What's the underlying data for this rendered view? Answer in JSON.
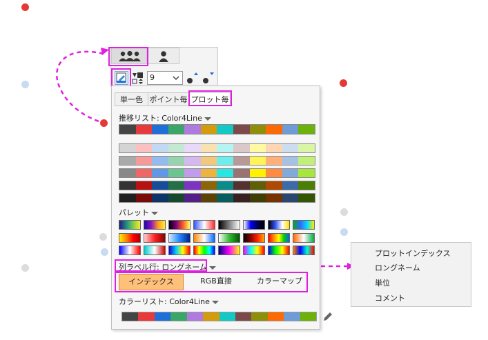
{
  "toolbar": {
    "tabs": [
      {
        "icon": "users-group-icon",
        "active": true
      },
      {
        "icon": "user-icon",
        "active": false
      }
    ],
    "size_value": "9"
  },
  "popup": {
    "tabs": [
      "単一色",
      "ポイント毎",
      "プロット毎"
    ],
    "active_tab": "プロット毎",
    "incremental_list_label": "推移リスト: Color4Line",
    "palette_label": "パレット",
    "column_label_row_label": "列ラベル行: ロングネーム",
    "mode_buttons": [
      "インデックス",
      "RGB直接",
      "カラーマップ"
    ],
    "active_mode": "インデックス",
    "color_list_label": "カラーリスト: Color4Line",
    "base_colors": [
      "#444444",
      "#e8393b",
      "#1f6fd8",
      "#3aa667",
      "#b07be0",
      "#d49b0c",
      "#12c9c6",
      "#7c4a4a",
      "#8e8e0b",
      "#ff6a00",
      "#6f9bd6",
      "#6cb20a"
    ],
    "shade_rows": [
      [
        "#d4d4d4",
        "#fbc1c1",
        "#c2d8f5",
        "#c5e8d3",
        "#e9d8f7",
        "#f8e3b0",
        "#b6f3f3",
        "#dbc8c8",
        "#fff9a3",
        "#ffd6b3",
        "#cdddf0",
        "#dbf5a6"
      ],
      [
        "#aaaaaa",
        "#f59999",
        "#94bbf0",
        "#95d4ae",
        "#d5b8f0",
        "#f2c97a",
        "#6dedec",
        "#b89898",
        "#fff455",
        "#ffb07a",
        "#a5c2e5",
        "#c2ee7a"
      ],
      [
        "#888888",
        "#ef6666",
        "#5f98e6",
        "#6bc590",
        "#c19bec",
        "#ecb43e",
        "#27e6e4",
        "#9a7272",
        "#fff100",
        "#ff8a40",
        "#81a9da",
        "#a6e63e"
      ],
      [
        "#333333",
        "#b81111",
        "#154d9b",
        "#237046",
        "#7d33c3",
        "#8c6505",
        "#0a8c8a",
        "#553232",
        "#5f5f07",
        "#b04a00",
        "#3d6aa8",
        "#4b7e04"
      ],
      [
        "#1f1f1f",
        "#7a0b0b",
        "#0e3468",
        "#164a2f",
        "#53208a",
        "#5d4303",
        "#075e5c",
        "#382121",
        "#3f3f05",
        "#753100",
        "#29476f",
        "#325403"
      ]
    ],
    "palettes": [
      [
        "linear-gradient(90deg,#2b1a7a,#1c8a8a,#7ad04a,#ffe62a)",
        "linear-gradient(90deg,#1a0aa6,#8e10c4,#ff9a1a,#ffee30)",
        "linear-gradient(90deg,#000000,#7a0080,#ff5a1a,#ffff66)",
        "linear-gradient(90deg,#3355ff,#ffffff,#ff2a2a)",
        "linear-gradient(90deg,#000000,#ffffff)",
        "linear-gradient(90deg,#ffffff,#0000ff,#000055,#000000)",
        "linear-gradient(90deg,#000000,#3355ff,#ffffff,#ffdd00)",
        "linear-gradient(90deg,#00aa22,#3366ff,#00ddff,#ffee00)"
      ],
      [
        "linear-gradient(90deg,#ffee00,#ff8800,#ff0000,#aa0000)",
        "linear-gradient(90deg,#ffd0d0,#ff2222,#880000)",
        "linear-gradient(90deg,#d0e8ff,#2288ff,#002288)",
        "linear-gradient(90deg,#ff8800,#ffffff,#0066ff)",
        "linear-gradient(90deg,#ffffff,#33bb33,#005500)",
        "linear-gradient(90deg,#000000,#880000,#ff2200,#ffaa00)",
        "linear-gradient(90deg,#ff0000,#ff8800,#ffff00,#00cc00,#0066ff)",
        "linear-gradient(90deg,#ff6600,#ffffff,#00aa44)"
      ],
      [
        "linear-gradient(90deg,#0000ff,#ffffff,#ff0000)",
        "linear-gradient(90deg,#00cccc,#ffffff,#cc0000)",
        "linear-gradient(90deg,#1a00cc,#00ccff,#ffff00,#ff0000)",
        "linear-gradient(90deg,#ff0000,#ffff00,#00ff00,#00ffff,#0000ff)",
        "linear-gradient(90deg,#000088,#ff00ff,#ffff00)",
        "linear-gradient(90deg,#ff00ff,#00ffff,#ffff00,#ff0000)",
        "linear-gradient(90deg,#0000ff,#00ff00,#ffff00,#ff0000)",
        "linear-gradient(90deg,#ff8800,#0000ff,#00ffcc,#ff0000)"
      ]
    ]
  },
  "dropdown_menu": {
    "items": [
      "プロットインデックス",
      "ロングネーム",
      "単位",
      "コメント"
    ]
  },
  "background_dots": [
    "#e53935",
    "#bcd3ef",
    "#e53935",
    "#d6d6d6",
    "#bcd3ef",
    "#e53935"
  ],
  "highlight_color": "#e020e0"
}
